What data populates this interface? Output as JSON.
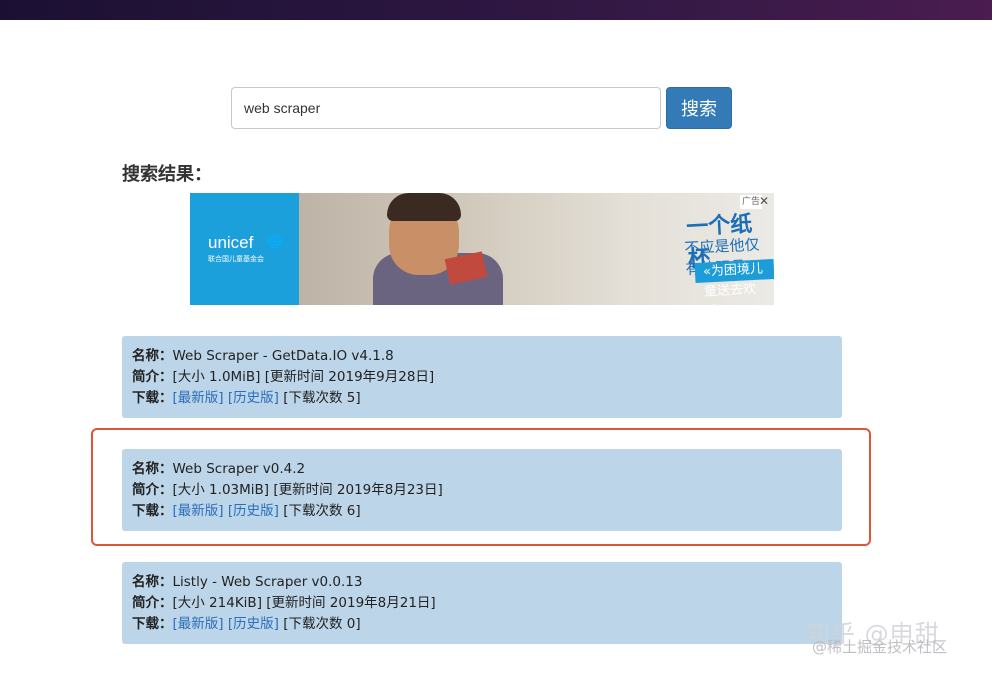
{
  "search": {
    "value": "web scraper",
    "button_label": "搜索"
  },
  "results_title": "搜索结果：",
  "ad": {
    "brand_name": "unicef",
    "brand_sub": "联合国儿童基金会",
    "tagline_main": "一个纸杯",
    "tagline_sub": "不应是他仅有的玩具",
    "cta": "«为困境儿童送去欢乐",
    "label": "广告",
    "close": "✕"
  },
  "labels": {
    "name": "名称：",
    "intro": "简介：",
    "download": "下载："
  },
  "results": [
    {
      "name": "Web Scraper - GetData.IO v4.1.8",
      "intro": "[大小 1.0MiB] [更新时间 2019年9月28日]",
      "latest": "[最新版]",
      "history": "[历史版]",
      "count": "[下载次数 5]"
    },
    {
      "name": "Web Scraper v0.4.2",
      "intro": "[大小 1.03MiB] [更新时间 2019年8月23日]",
      "latest": "[最新版]",
      "history": "[历史版]",
      "count": "[下载次数 6]"
    },
    {
      "name": "Listly - Web Scraper v0.0.13",
      "intro": "[大小 214KiB] [更新时间 2019年8月21日]",
      "latest": "[最新版]",
      "history": "[历史版]",
      "count": "[下载次数 0]"
    }
  ],
  "watermark": {
    "line1": "知乎 @申甜",
    "line2": "@稀土掘金技术社区"
  },
  "colors": {
    "card_bg": "#bcd5e8",
    "button": "#337ab7",
    "link": "#2a6ebb",
    "highlight": "#e0543a"
  }
}
